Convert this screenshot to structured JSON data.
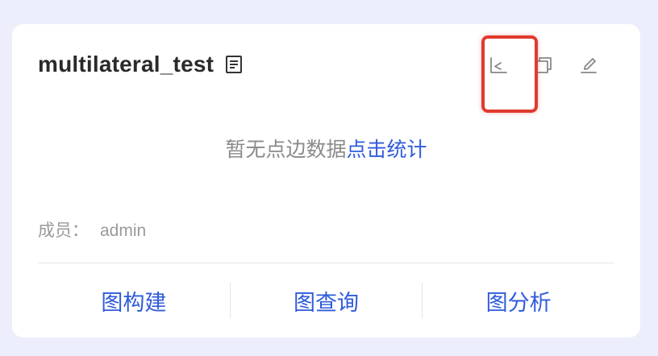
{
  "card": {
    "title": "multilateral_test",
    "icons": {
      "title": "document-icon",
      "action_1": "line-chart-icon",
      "action_2": "copy-icon",
      "action_3": "edit-pencil-icon"
    },
    "highlight_color": "#e03a2e"
  },
  "empty_state": {
    "text": "暂无点边数据",
    "link_text": "点击统计"
  },
  "members": {
    "label": "成员：",
    "value": "admin"
  },
  "footer": {
    "buttons": [
      "图构建",
      "图查询",
      "图分析"
    ]
  },
  "colors": {
    "background": "#eceffb",
    "card": "#ffffff",
    "accent": "#2f5bdc",
    "muted_text": "#8a8a8a",
    "icon": "#888888"
  }
}
